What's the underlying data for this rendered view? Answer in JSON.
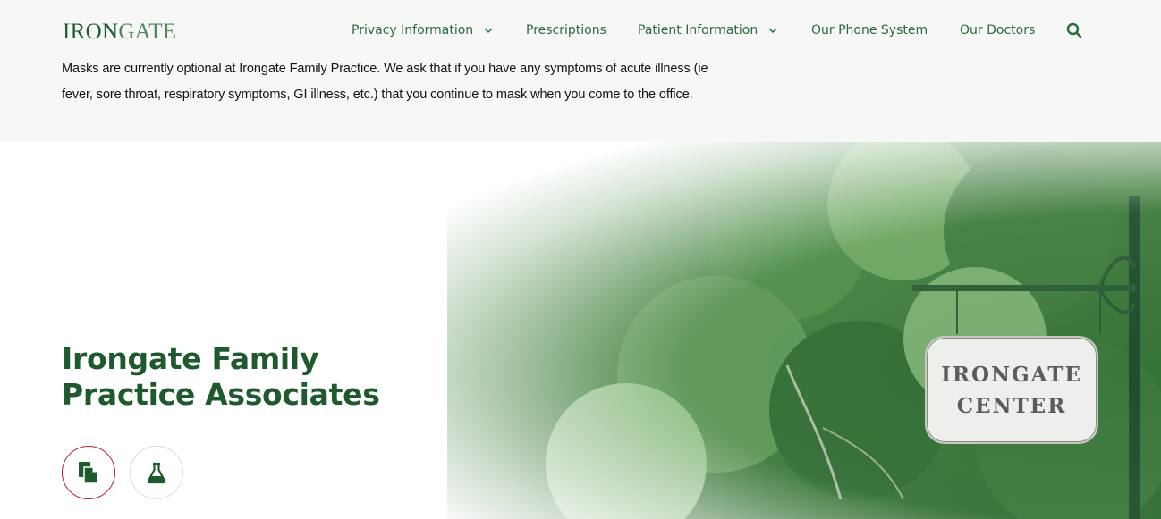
{
  "brand": {
    "logo_text_bold": "IRON",
    "logo_text_light": "GATE"
  },
  "nav": {
    "items": [
      {
        "label": "Privacy Information",
        "has_dropdown": true
      },
      {
        "label": "Prescriptions",
        "has_dropdown": false
      },
      {
        "label": "Patient Information",
        "has_dropdown": true
      },
      {
        "label": "Our Phone System",
        "has_dropdown": false
      },
      {
        "label": "Our Doctors",
        "has_dropdown": false
      }
    ],
    "search_icon": "search-icon"
  },
  "notice": {
    "text": "Masks are currently optional at Irongate Family Practice. We ask that if you have any symptoms of acute illness (ie fever, sore throat, respiratory symptoms, GI illness, etc.) that you continue to mask when you come to the office."
  },
  "hero": {
    "title_line1": "Irongate Family",
    "title_line2": "Practice Associates",
    "sign_line1": "IRONGATE",
    "sign_line2": "CENTER",
    "buttons": [
      {
        "icon": "documents-icon"
      },
      {
        "icon": "flask-icon"
      }
    ]
  },
  "colors": {
    "brand_green": "#1e5a2e",
    "nav_green": "#2b6a3c",
    "accent_red": "#b3233a",
    "topbar_bg": "#f7f7f7"
  }
}
